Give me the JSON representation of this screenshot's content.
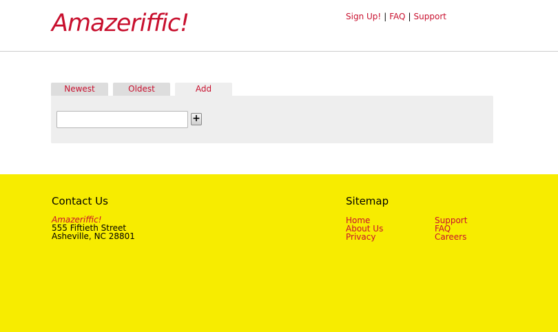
{
  "header": {
    "logo": "Amazeriffic!",
    "nav": [
      "Sign Up!",
      "FAQ",
      "Support"
    ],
    "separator": "|"
  },
  "tabs": [
    {
      "label": "Newest"
    },
    {
      "label": "Oldest"
    },
    {
      "label": "Add",
      "active": true
    }
  ],
  "add_form": {
    "input_value": "",
    "button_label": "+"
  },
  "footer": {
    "contact": {
      "heading": "Contact Us",
      "company": "Amazeriffic!",
      "street": "555 Fiftieth Street",
      "city": "Asheville, NC 28801"
    },
    "sitemap": {
      "heading": "Sitemap",
      "col1": [
        "Home",
        "About Us",
        "Privacy"
      ],
      "col2": [
        "Support",
        "FAQ",
        "Careers"
      ]
    }
  },
  "colors": {
    "brand_red": "#c8102e",
    "footer_yellow": "#f7ec00",
    "panel_gray": "#eeeeee"
  }
}
